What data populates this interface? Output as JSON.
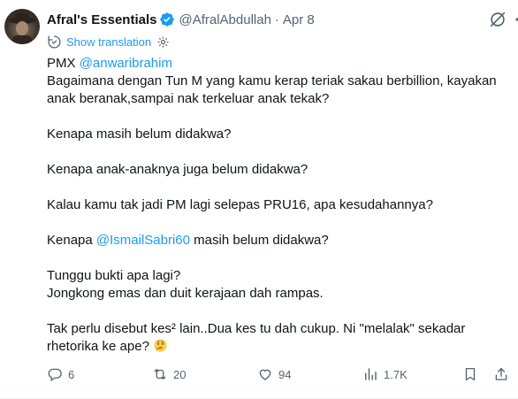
{
  "author": {
    "name": "Afral's Essentials",
    "handle": "@AfralAbdullah",
    "separator": "·",
    "date": "Apr 8"
  },
  "translation": {
    "label": "Show translation"
  },
  "tweet": {
    "line1_prefix": "PMX ",
    "line1_mention": "@anwaribrahim",
    "line2": "Bagaimana dengan Tun M yang kamu kerap teriak sakau berbillion, kayakan anak beranak,sampai nak terkeluar anak tekak?",
    "line3": "Kenapa masih belum didakwa?",
    "line4": "Kenapa anak-anaknya juga belum didakwa?",
    "line5": "Kalau kamu tak jadi PM lagi selepas PRU16, apa kesudahannya?",
    "line6_prefix": "Kenapa ",
    "line6_mention": "@IsmailSabri60",
    "line6_suffix": " masih belum didakwa?",
    "line7": "Tunggu bukti apa lagi?",
    "line8": "Jongkong emas dan duit kerajaan dah rampas.",
    "line9": "Tak perlu disebut kes² lain..Dua kes tu dah cukup. Ni \"melalak\" sekadar rhetorika ke ape?",
    "emoji": "thinking-face"
  },
  "actions": {
    "replies": "6",
    "reposts": "20",
    "likes": "94",
    "views": "1.7K"
  },
  "colors": {
    "accent": "#1d9bf0",
    "text": "#0f1419",
    "muted": "#536471"
  }
}
